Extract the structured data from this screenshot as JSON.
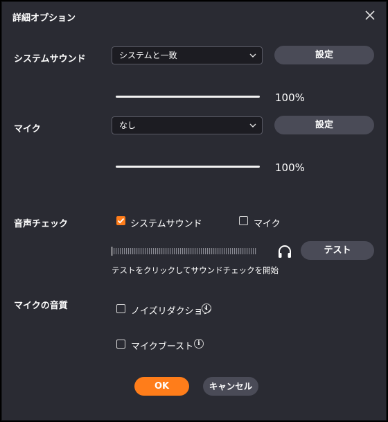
{
  "dialog": {
    "title": "詳細オプション"
  },
  "system_sound": {
    "label": "システムサウンド",
    "select_value": "システムと一致",
    "settings_button": "設定",
    "volume_percent_label": "100%",
    "volume_fraction": 1.0
  },
  "mic": {
    "label": "マイク",
    "select_value": "なし",
    "settings_button": "設定",
    "volume_percent_label": "100%",
    "volume_fraction": 1.0
  },
  "audio_check": {
    "label": "音声チェック",
    "system_sound_checkbox": "システムサウンド",
    "system_sound_checked": true,
    "mic_checkbox": "マイク",
    "mic_checked": false,
    "test_button": "テスト",
    "hint": "テストをクリックしてサウンドチェックを開始"
  },
  "mic_quality": {
    "label": "マイクの音質",
    "noise_reduction": "ノイズリダクション",
    "noise_reduction_checked": false,
    "mic_boost": "マイクブースト",
    "mic_boost_checked": false
  },
  "footer": {
    "ok": "OK",
    "cancel": "キャンセル"
  },
  "icons": {
    "close": "close-icon",
    "chevron": "chevron-down-icon",
    "headphones": "headphones-icon",
    "info": "info-icon",
    "check": "check-icon"
  },
  "colors": {
    "accent": "#ff7d1a",
    "background": "#2a2b33",
    "button": "#4a4b57"
  }
}
